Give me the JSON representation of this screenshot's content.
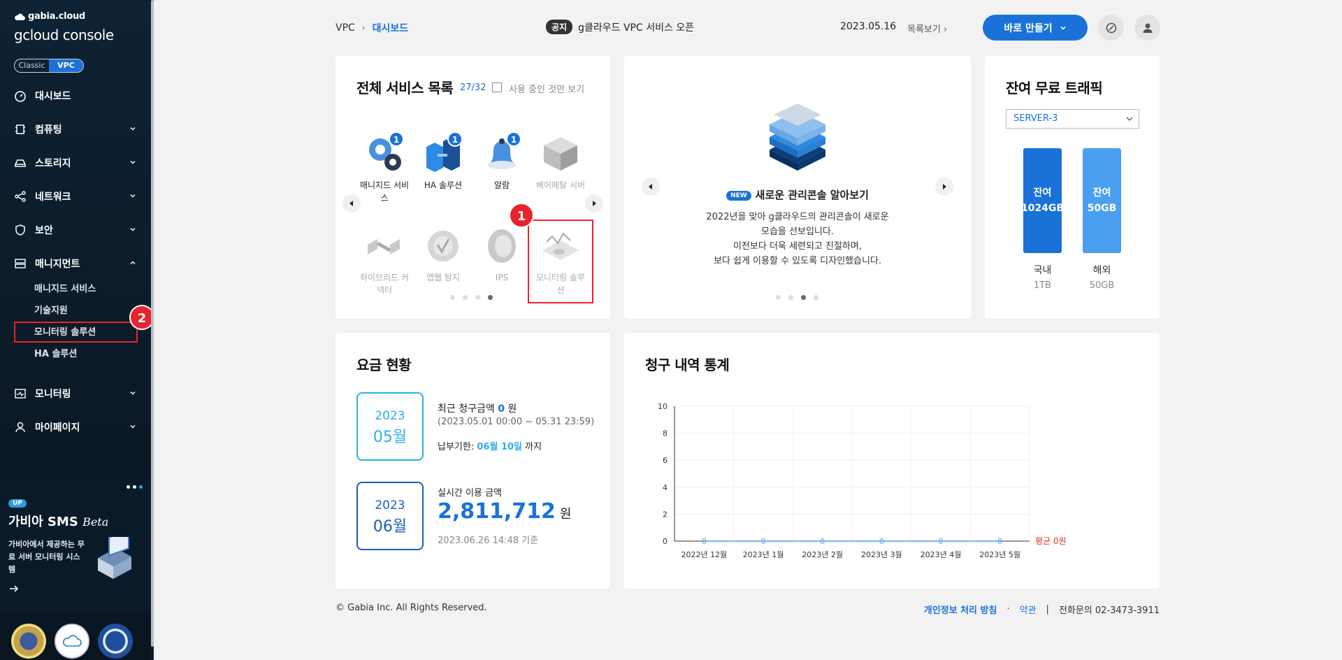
{
  "sidebar": {
    "brand_small": "gabia.cloud",
    "brand_big": "gcloud console",
    "mode": {
      "classic": "Classic",
      "vpc": "VPC"
    },
    "items": [
      {
        "label": "대시보드"
      },
      {
        "label": "컴퓨팅"
      },
      {
        "label": "스토리지"
      },
      {
        "label": "네트워크"
      },
      {
        "label": "보안"
      },
      {
        "label": "매니지먼트"
      },
      {
        "label": "모니터링"
      },
      {
        "label": "마이페이지"
      }
    ],
    "sub_items": [
      {
        "label": "매니지드 서비스"
      },
      {
        "label": "기술지원"
      },
      {
        "label": "모니터링 솔루션"
      },
      {
        "label": "HA 솔루션"
      }
    ],
    "callout": "2",
    "promo": {
      "up": "UP",
      "title": "가비아 SMS",
      "beta": "Beta",
      "desc": "가비아에서 제공하는 무료 서버 모니터링 시스템"
    }
  },
  "header": {
    "breadcrumb": [
      "VPC",
      "대시보드"
    ],
    "notice_tag": "공지",
    "notice_text": "g클라우드 VPC 서비스 오픈",
    "notice_date": "2023.05.16",
    "more": "목록보기",
    "create": "바로 만들기"
  },
  "services": {
    "title": "전체 서비스 목록",
    "count": "27/32",
    "filter_label": "사용 중인 것만 보기",
    "callout": "1",
    "row1": [
      {
        "label": "매니지드 서비스",
        "badge": "1"
      },
      {
        "label": "HA 솔루션",
        "badge": "1"
      },
      {
        "label": "알람",
        "badge": "1"
      },
      {
        "label": "베어메탈 서버"
      }
    ],
    "row2": [
      {
        "label": "하이브리드 커넥터"
      },
      {
        "label": "앱웹 탐지"
      },
      {
        "label": "IPS"
      },
      {
        "label": "모니터링 솔루션"
      }
    ]
  },
  "news": {
    "new_tag": "NEW",
    "title": "새로운 관리콘솔 알아보기",
    "desc": [
      "2022년을 맞아 g클라우드의 관리콘솔이 새로운",
      "모습을 선보입니다.",
      "이전보다 더욱 세련되고 친절하며,",
      "보다 쉽게 이용할 수 있도록 디자인했습니다."
    ]
  },
  "traffic": {
    "title": "잔여 무료 트래픽",
    "server": "SERVER-3",
    "bars": [
      {
        "top": "잔여",
        "value": "1024GB",
        "label": "국내",
        "total": "1TB",
        "color": "#1a72d9"
      },
      {
        "top": "잔여",
        "value": "50GB",
        "label": "해외",
        "total": "50GB",
        "color": "#4b9ff0"
      }
    ]
  },
  "billing": {
    "title": "요금 현황",
    "box1": {
      "year": "2023",
      "month": "05월"
    },
    "recent_label": "최근 청구금액",
    "recent_amount": "0",
    "won": "원",
    "period": "(2023.05.01 00:00 ~ 05.31 23:59)",
    "due_prefix": "납부기한:",
    "due_date": "06월 10일",
    "due_suffix": "까지",
    "box2": {
      "year": "2023",
      "month": "06월"
    },
    "realtime_label": "실시간 이용 금액",
    "realtime_amount": "2,811,712",
    "realtime_time": "2023.06.26 14:48 기준"
  },
  "stats": {
    "title": "청구 내역 통계",
    "avg_label": "평균 0원"
  },
  "chart_data": {
    "type": "line",
    "categories": [
      "2022년 12월",
      "2023년 1월",
      "2023년 2월",
      "2023년 3월",
      "2023년 4월",
      "2023년 5월"
    ],
    "values": [
      0,
      0,
      0,
      0,
      0,
      0
    ],
    "yticks": [
      0,
      2,
      4,
      6,
      8,
      10
    ],
    "ylim": [
      0,
      10
    ],
    "grid": true,
    "series_color": "#4b9ff0"
  },
  "footer": {
    "copyright": "© Gabia Inc. All Rights Reserved.",
    "privacy": "개인정보 처리 방침",
    "dot": "·",
    "terms": "약관",
    "bar": "|",
    "phone_label": "전화문의",
    "phone": "02-3473-3911"
  }
}
